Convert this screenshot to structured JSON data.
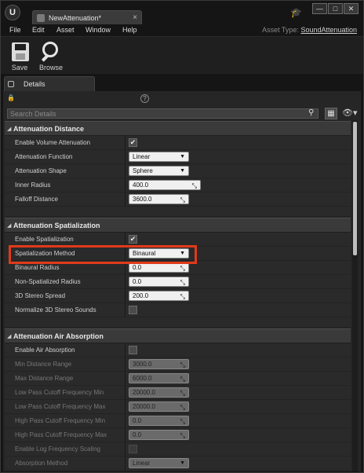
{
  "window": {
    "logo": "U",
    "tab_title": "NewAttenuation*",
    "tab_close": "×",
    "controls": {
      "minimize": "—",
      "maximize": "□",
      "close": "✕"
    }
  },
  "menubar": {
    "items": [
      "File",
      "Edit",
      "Asset",
      "Window",
      "Help"
    ],
    "asset_type_label": "Asset Type:",
    "asset_type_value": "SoundAttenuation"
  },
  "toolbar": {
    "save_label": "Save",
    "browse_label": "Browse"
  },
  "details": {
    "tab_label": "Details",
    "search_placeholder": "Search Details"
  },
  "categories": [
    {
      "title": "Attenuation Distance",
      "rows": [
        {
          "name": "Enable Volume Attenuation",
          "type": "checkbox",
          "checked": true
        },
        {
          "name": "Attenuation Function",
          "type": "dropdown",
          "value": "Linear"
        },
        {
          "name": "Attenuation Shape",
          "type": "dropdown",
          "value": "Sphere"
        },
        {
          "name": "Inner Radius",
          "type": "number",
          "value": "400.0"
        },
        {
          "name": "Falloff Distance",
          "type": "number",
          "value": "3600.0"
        }
      ]
    },
    {
      "title": "Attenuation Spatialization",
      "rows": [
        {
          "name": "Enable Spatialization",
          "type": "checkbox",
          "checked": true
        },
        {
          "name": "Spatialization Method",
          "type": "dropdown",
          "value": "Binaural"
        },
        {
          "name": "Binaural Radius",
          "type": "number",
          "value": "0.0"
        },
        {
          "name": "Non-Spatialized Radius",
          "type": "number",
          "value": "0.0"
        },
        {
          "name": "3D Stereo Spread",
          "type": "number",
          "value": "200.0"
        },
        {
          "name": "Normalize 3D Stereo Sounds",
          "type": "checkbox",
          "checked": false
        }
      ]
    },
    {
      "title": "Attenuation Air Absorption",
      "rows": [
        {
          "name": "Enable Air Absorption",
          "type": "checkbox",
          "checked": false
        },
        {
          "name": "Min Distance Range",
          "type": "number",
          "value": "3000.0",
          "disabled": true
        },
        {
          "name": "Max Distance Range",
          "type": "number",
          "value": "6000.0",
          "disabled": true
        },
        {
          "name": "Low Pass Cutoff Frequency Min",
          "type": "number",
          "value": "20000.0",
          "disabled": true
        },
        {
          "name": "Low Pass Cutoff Frequency Max",
          "type": "number",
          "value": "20000.0",
          "disabled": true
        },
        {
          "name": "High Pass Cutoff Frequency Min",
          "type": "number",
          "value": "0.0",
          "disabled": true
        },
        {
          "name": "High Pass Cutoff Frequency Max",
          "type": "number",
          "value": "0.0",
          "disabled": true
        },
        {
          "name": "Enable Log Frequency Scaling",
          "type": "checkbox",
          "checked": false,
          "disabled": true
        },
        {
          "name": "Absorption Method",
          "type": "dropdown",
          "value": "Linear",
          "disabled": true
        }
      ]
    }
  ],
  "highlight_color": "#e03a1a"
}
